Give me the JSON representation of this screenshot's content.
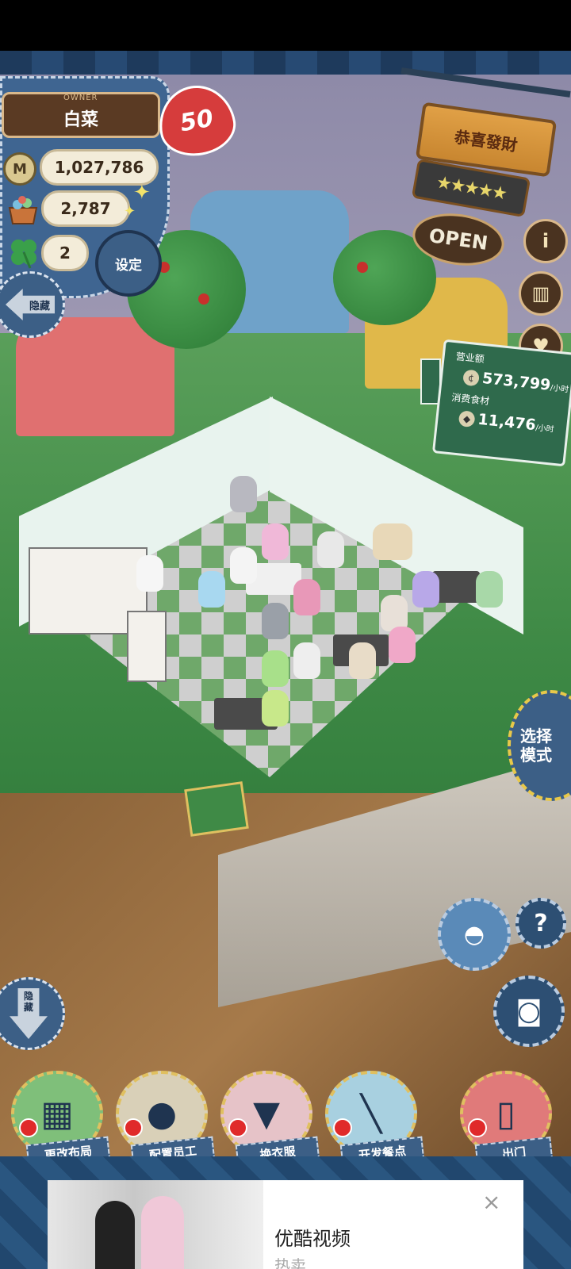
{
  "owner": {
    "label": "OWNER",
    "name": "白菜",
    "level": "50"
  },
  "stats": {
    "money": "1,027,786",
    "ingredients": "2,787",
    "clovers": "2"
  },
  "buttons": {
    "settings": "设定",
    "hide_top": "隐藏",
    "hide_bottom_line1": "隐",
    "hide_bottom_line2": "藏",
    "mode_line1": "选择",
    "mode_line2": "模式"
  },
  "shop": {
    "name": "恭喜發財",
    "stars": "★★★★★",
    "status": "OPEN"
  },
  "revenue": {
    "sales_label": "营业额",
    "sales_value": "573,799",
    "sales_unit": "/小时",
    "consumption_label": "消费食材",
    "consumption_value": "11,476",
    "consumption_unit": "/小时"
  },
  "actions": [
    {
      "label": "更改布局",
      "icon": "table-icon",
      "color": "#7fbf7a"
    },
    {
      "label": "配置员工",
      "icon": "bear-head-icon",
      "color": "#d9d0b8"
    },
    {
      "label": "换衣服",
      "icon": "shirt-icon",
      "color": "#e6c3c8"
    },
    {
      "label": "开发餐点",
      "icon": "knife-icon",
      "color": "#a8d0e0"
    },
    {
      "label": "出门",
      "icon": "door-icon",
      "color": "#e07a7a"
    }
  ],
  "ad": {
    "title": "优酷视频",
    "subtitle": "热卖",
    "close": "×"
  },
  "colors": {
    "denim": "#3c5f86",
    "stitch": "#e0c060",
    "pin": "#e02a2a",
    "board": "#2f6a4c"
  }
}
